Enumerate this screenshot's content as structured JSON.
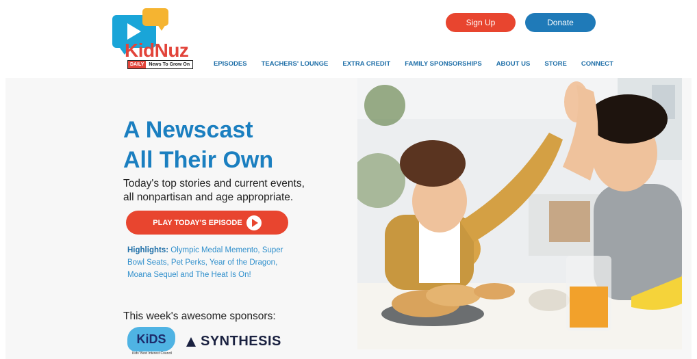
{
  "logo": {
    "word": "KidNuz",
    "tag_daily": "DAILY",
    "tag_rest": "News To Grow On"
  },
  "header": {
    "signup_label": "Sign Up",
    "donate_label": "Donate"
  },
  "nav": [
    "EPISODES",
    "TEACHERS' LOUNGE",
    "EXTRA CREDIT",
    "FAMILY SPONSORSHIPS",
    "ABOUT US",
    "STORE",
    "CONNECT"
  ],
  "hero": {
    "headline_1": "A Newscast",
    "headline_2": "All Their Own",
    "subtext_1": "Today's top stories and current events,",
    "subtext_2": "all nonpartisan and age appropriate.",
    "play_label": "PLAY TODAY'S EPISODE",
    "highlights_label": "Highlights:",
    "highlights_text": "Olympic Medal Memento, Super Bowl Seats, Pet Perks, Year of the Dragon, Moana Sequel and The Heat Is On!",
    "sponsors_title": "This week's awesome sponsors:"
  },
  "sponsors": {
    "kids_name": "KiDS",
    "kids_tag": "Kids' Best Interest Council",
    "synthesis_name": "SYNTHESIS"
  },
  "colors": {
    "accent_red": "#e8452f",
    "brand_blue": "#1b7fc0",
    "donate_blue": "#1f7ab8"
  }
}
